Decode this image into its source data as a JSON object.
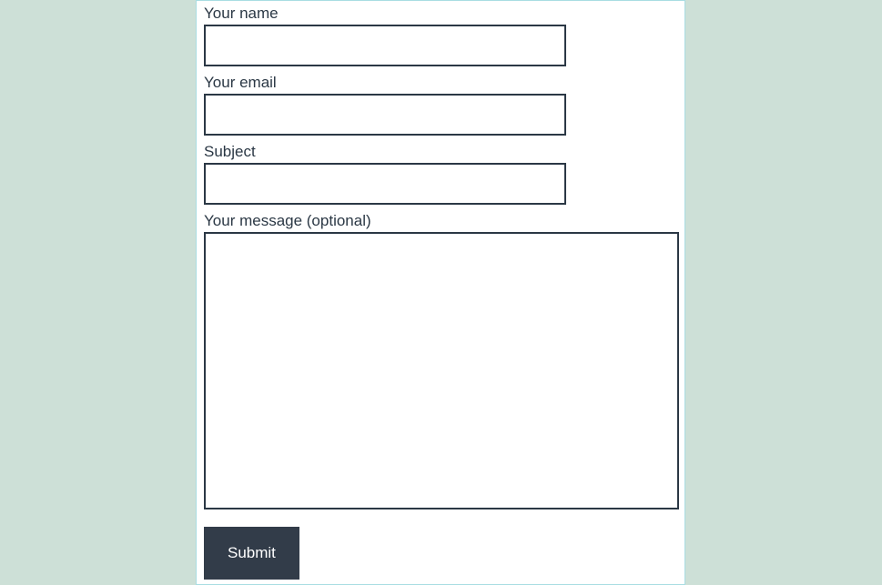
{
  "form": {
    "name": {
      "label": "Your name",
      "value": ""
    },
    "email": {
      "label": "Your email",
      "value": ""
    },
    "subject": {
      "label": "Subject",
      "value": ""
    },
    "message": {
      "label": "Your message (optional)",
      "value": ""
    },
    "submit_label": "Submit"
  },
  "colors": {
    "page_bg": "#cde0d7",
    "container_bg": "#ffffff",
    "container_border": "#a9dde2",
    "text": "#2b3845",
    "input_border": "#2b3845",
    "button_bg": "#323c49",
    "button_text": "#ffffff"
  }
}
